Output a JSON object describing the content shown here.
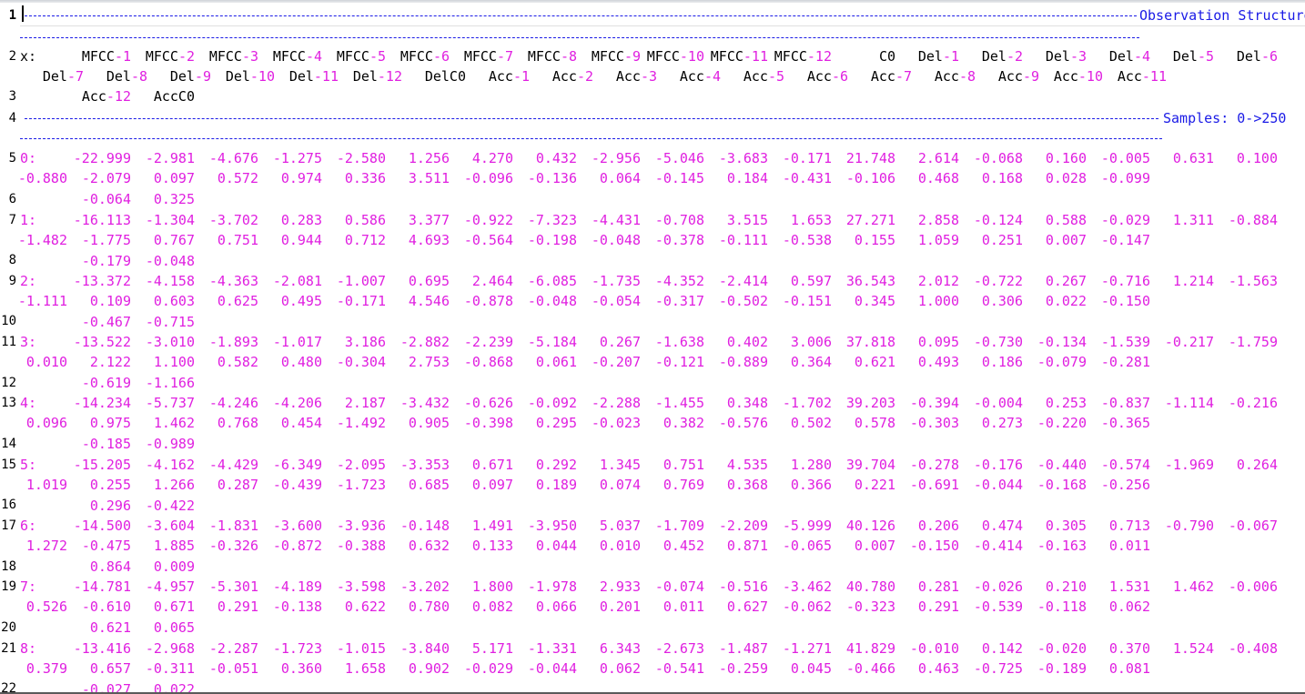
{
  "editor": {
    "observation_label": "Observation Structure",
    "samples_label": "Samples: 0->250",
    "x_label": "x:",
    "line_numbers": [
      "1",
      "2",
      "3",
      "4",
      "5",
      "6",
      "7",
      "8",
      "9",
      "10",
      "11",
      "12",
      "13",
      "14",
      "15",
      "16",
      "17",
      "18",
      "19",
      "20",
      "21",
      "22"
    ],
    "header_lines": [
      [
        "MFCC-1",
        "MFCC-2",
        "MFCC-3",
        "MFCC-4",
        "MFCC-5",
        "MFCC-6",
        "MFCC-7",
        "MFCC-8",
        "MFCC-9",
        "MFCC-10",
        "MFCC-11",
        "MFCC-12",
        "C0",
        "Del-1",
        "Del-2",
        "Del-3",
        "Del-4",
        "Del-5",
        "Del-6"
      ],
      [
        "Del-7",
        "Del-8",
        "Del-9",
        "Del-10",
        "Del-11",
        "Del-12",
        "DelC0",
        "Acc-1",
        "Acc-2",
        "Acc-3",
        "Acc-4",
        "Acc-5",
        "Acc-6",
        "Acc-7",
        "Acc-8",
        "Acc-9",
        "Acc-10",
        "Acc-11"
      ],
      [
        "Acc-12",
        "AccC0"
      ]
    ],
    "samples": [
      {
        "index": "0:",
        "l1": [
          "-22.999",
          "-2.981",
          "-4.676",
          "-1.275",
          "-2.580",
          "1.256",
          "4.270",
          "0.432",
          "-2.956",
          "-5.046",
          "-3.683",
          "-0.171",
          "21.748",
          "2.614",
          "-0.068",
          "0.160",
          "-0.005",
          "0.631",
          "0.100"
        ],
        "l2": [
          "-0.880",
          "-2.079",
          "0.097",
          "0.572",
          "0.974",
          "0.336",
          "3.511",
          "-0.096",
          "-0.136",
          "0.064",
          "-0.145",
          "0.184",
          "-0.431",
          "-0.106",
          "0.468",
          "0.168",
          "0.028",
          "-0.099"
        ],
        "l3": [
          "-0.064",
          "0.325"
        ]
      },
      {
        "index": "1:",
        "l1": [
          "-16.113",
          "-1.304",
          "-3.702",
          "0.283",
          "0.586",
          "3.377",
          "-0.922",
          "-7.323",
          "-4.431",
          "-0.708",
          "3.515",
          "1.653",
          "27.271",
          "2.858",
          "-0.124",
          "0.588",
          "-0.029",
          "1.311",
          "-0.884"
        ],
        "l2": [
          "-1.482",
          "-1.775",
          "0.767",
          "0.751",
          "0.944",
          "0.712",
          "4.693",
          "-0.564",
          "-0.198",
          "-0.048",
          "-0.378",
          "-0.111",
          "-0.538",
          "0.155",
          "1.059",
          "0.251",
          "0.007",
          "-0.147"
        ],
        "l3": [
          "-0.179",
          "-0.048"
        ]
      },
      {
        "index": "2:",
        "l1": [
          "-13.372",
          "-4.158",
          "-4.363",
          "-2.081",
          "-1.007",
          "0.695",
          "2.464",
          "-6.085",
          "-1.735",
          "-4.352",
          "-2.414",
          "0.597",
          "36.543",
          "2.012",
          "-0.722",
          "0.267",
          "-0.716",
          "1.214",
          "-1.563"
        ],
        "l2": [
          "-1.111",
          "0.109",
          "0.603",
          "0.625",
          "0.495",
          "-0.171",
          "4.546",
          "-0.878",
          "-0.048",
          "-0.054",
          "-0.317",
          "-0.502",
          "-0.151",
          "0.345",
          "1.000",
          "0.306",
          "0.022",
          "-0.150"
        ],
        "l3": [
          "-0.467",
          "-0.715"
        ]
      },
      {
        "index": "3:",
        "l1": [
          "-13.522",
          "-3.010",
          "-1.893",
          "-1.017",
          "3.186",
          "-2.882",
          "-2.239",
          "-5.184",
          "0.267",
          "-1.638",
          "0.402",
          "3.006",
          "37.818",
          "0.095",
          "-0.730",
          "-0.134",
          "-1.539",
          "-0.217",
          "-1.759"
        ],
        "l2": [
          "0.010",
          "2.122",
          "1.100",
          "0.582",
          "0.480",
          "-0.304",
          "2.753",
          "-0.868",
          "0.061",
          "-0.207",
          "-0.121",
          "-0.889",
          "0.364",
          "0.621",
          "0.493",
          "0.186",
          "-0.079",
          "-0.281"
        ],
        "l3": [
          "-0.619",
          "-1.166"
        ]
      },
      {
        "index": "4:",
        "l1": [
          "-14.234",
          "-5.737",
          "-4.246",
          "-4.206",
          "2.187",
          "-3.432",
          "-0.626",
          "-0.092",
          "-2.288",
          "-1.455",
          "0.348",
          "-1.702",
          "39.203",
          "-0.394",
          "-0.004",
          "0.253",
          "-0.837",
          "-1.114",
          "-0.216"
        ],
        "l2": [
          "0.096",
          "0.975",
          "1.462",
          "0.768",
          "0.454",
          "-1.492",
          "0.905",
          "-0.398",
          "0.295",
          "-0.023",
          "0.382",
          "-0.576",
          "0.502",
          "0.578",
          "-0.303",
          "0.273",
          "-0.220",
          "-0.365"
        ],
        "l3": [
          "-0.185",
          "-0.989"
        ]
      },
      {
        "index": "5:",
        "l1": [
          "-15.205",
          "-4.162",
          "-4.429",
          "-6.349",
          "-2.095",
          "-3.353",
          "0.671",
          "0.292",
          "1.345",
          "0.751",
          "4.535",
          "1.280",
          "39.704",
          "-0.278",
          "-0.176",
          "-0.440",
          "-0.574",
          "-1.969",
          "0.264"
        ],
        "l2": [
          "1.019",
          "0.255",
          "1.266",
          "0.287",
          "-0.439",
          "-1.723",
          "0.685",
          "0.097",
          "0.189",
          "0.074",
          "0.769",
          "0.368",
          "0.366",
          "0.221",
          "-0.691",
          "-0.044",
          "-0.168",
          "-0.256"
        ],
        "l3": [
          "0.296",
          "-0.422"
        ]
      },
      {
        "index": "6:",
        "l1": [
          "-14.500",
          "-3.604",
          "-1.831",
          "-3.600",
          "-3.936",
          "-0.148",
          "1.491",
          "-3.950",
          "5.037",
          "-1.709",
          "-2.209",
          "-5.999",
          "40.126",
          "0.206",
          "0.474",
          "0.305",
          "0.713",
          "-0.790",
          "-0.067"
        ],
        "l2": [
          "1.272",
          "-0.475",
          "1.885",
          "-0.326",
          "-0.872",
          "-0.388",
          "0.632",
          "0.133",
          "0.044",
          "0.010",
          "0.452",
          "0.871",
          "-0.065",
          "0.007",
          "-0.150",
          "-0.414",
          "-0.163",
          "0.011"
        ],
        "l3": [
          "0.864",
          "0.009"
        ]
      },
      {
        "index": "7:",
        "l1": [
          "-14.781",
          "-4.957",
          "-5.301",
          "-4.189",
          "-3.598",
          "-3.202",
          "1.800",
          "-1.978",
          "2.933",
          "-0.074",
          "-0.516",
          "-3.462",
          "40.780",
          "0.281",
          "-0.026",
          "0.210",
          "1.531",
          "1.462",
          "-0.006"
        ],
        "l2": [
          "0.526",
          "-0.610",
          "0.671",
          "0.291",
          "-0.138",
          "0.622",
          "0.780",
          "0.082",
          "0.066",
          "0.201",
          "0.011",
          "0.627",
          "-0.062",
          "-0.323",
          "0.291",
          "-0.539",
          "-0.118",
          "0.062"
        ],
        "l3": [
          "0.621",
          "0.065"
        ]
      },
      {
        "index": "8:",
        "l1": [
          "-13.416",
          "-2.968",
          "-2.287",
          "-1.723",
          "-1.015",
          "-3.840",
          "5.171",
          "-1.331",
          "6.343",
          "-2.673",
          "-1.487",
          "-1.271",
          "41.829",
          "-0.010",
          "0.142",
          "-0.020",
          "0.370",
          "1.524",
          "-0.408"
        ],
        "l2": [
          "0.379",
          "0.657",
          "-0.311",
          "-0.051",
          "0.360",
          "1.658",
          "0.902",
          "-0.029",
          "-0.044",
          "0.062",
          "-0.541",
          "-0.259",
          "0.045",
          "-0.466",
          "0.463",
          "-0.725",
          "-0.189",
          "0.081"
        ],
        "l3": [
          "-0.027",
          "0.022"
        ]
      }
    ]
  }
}
